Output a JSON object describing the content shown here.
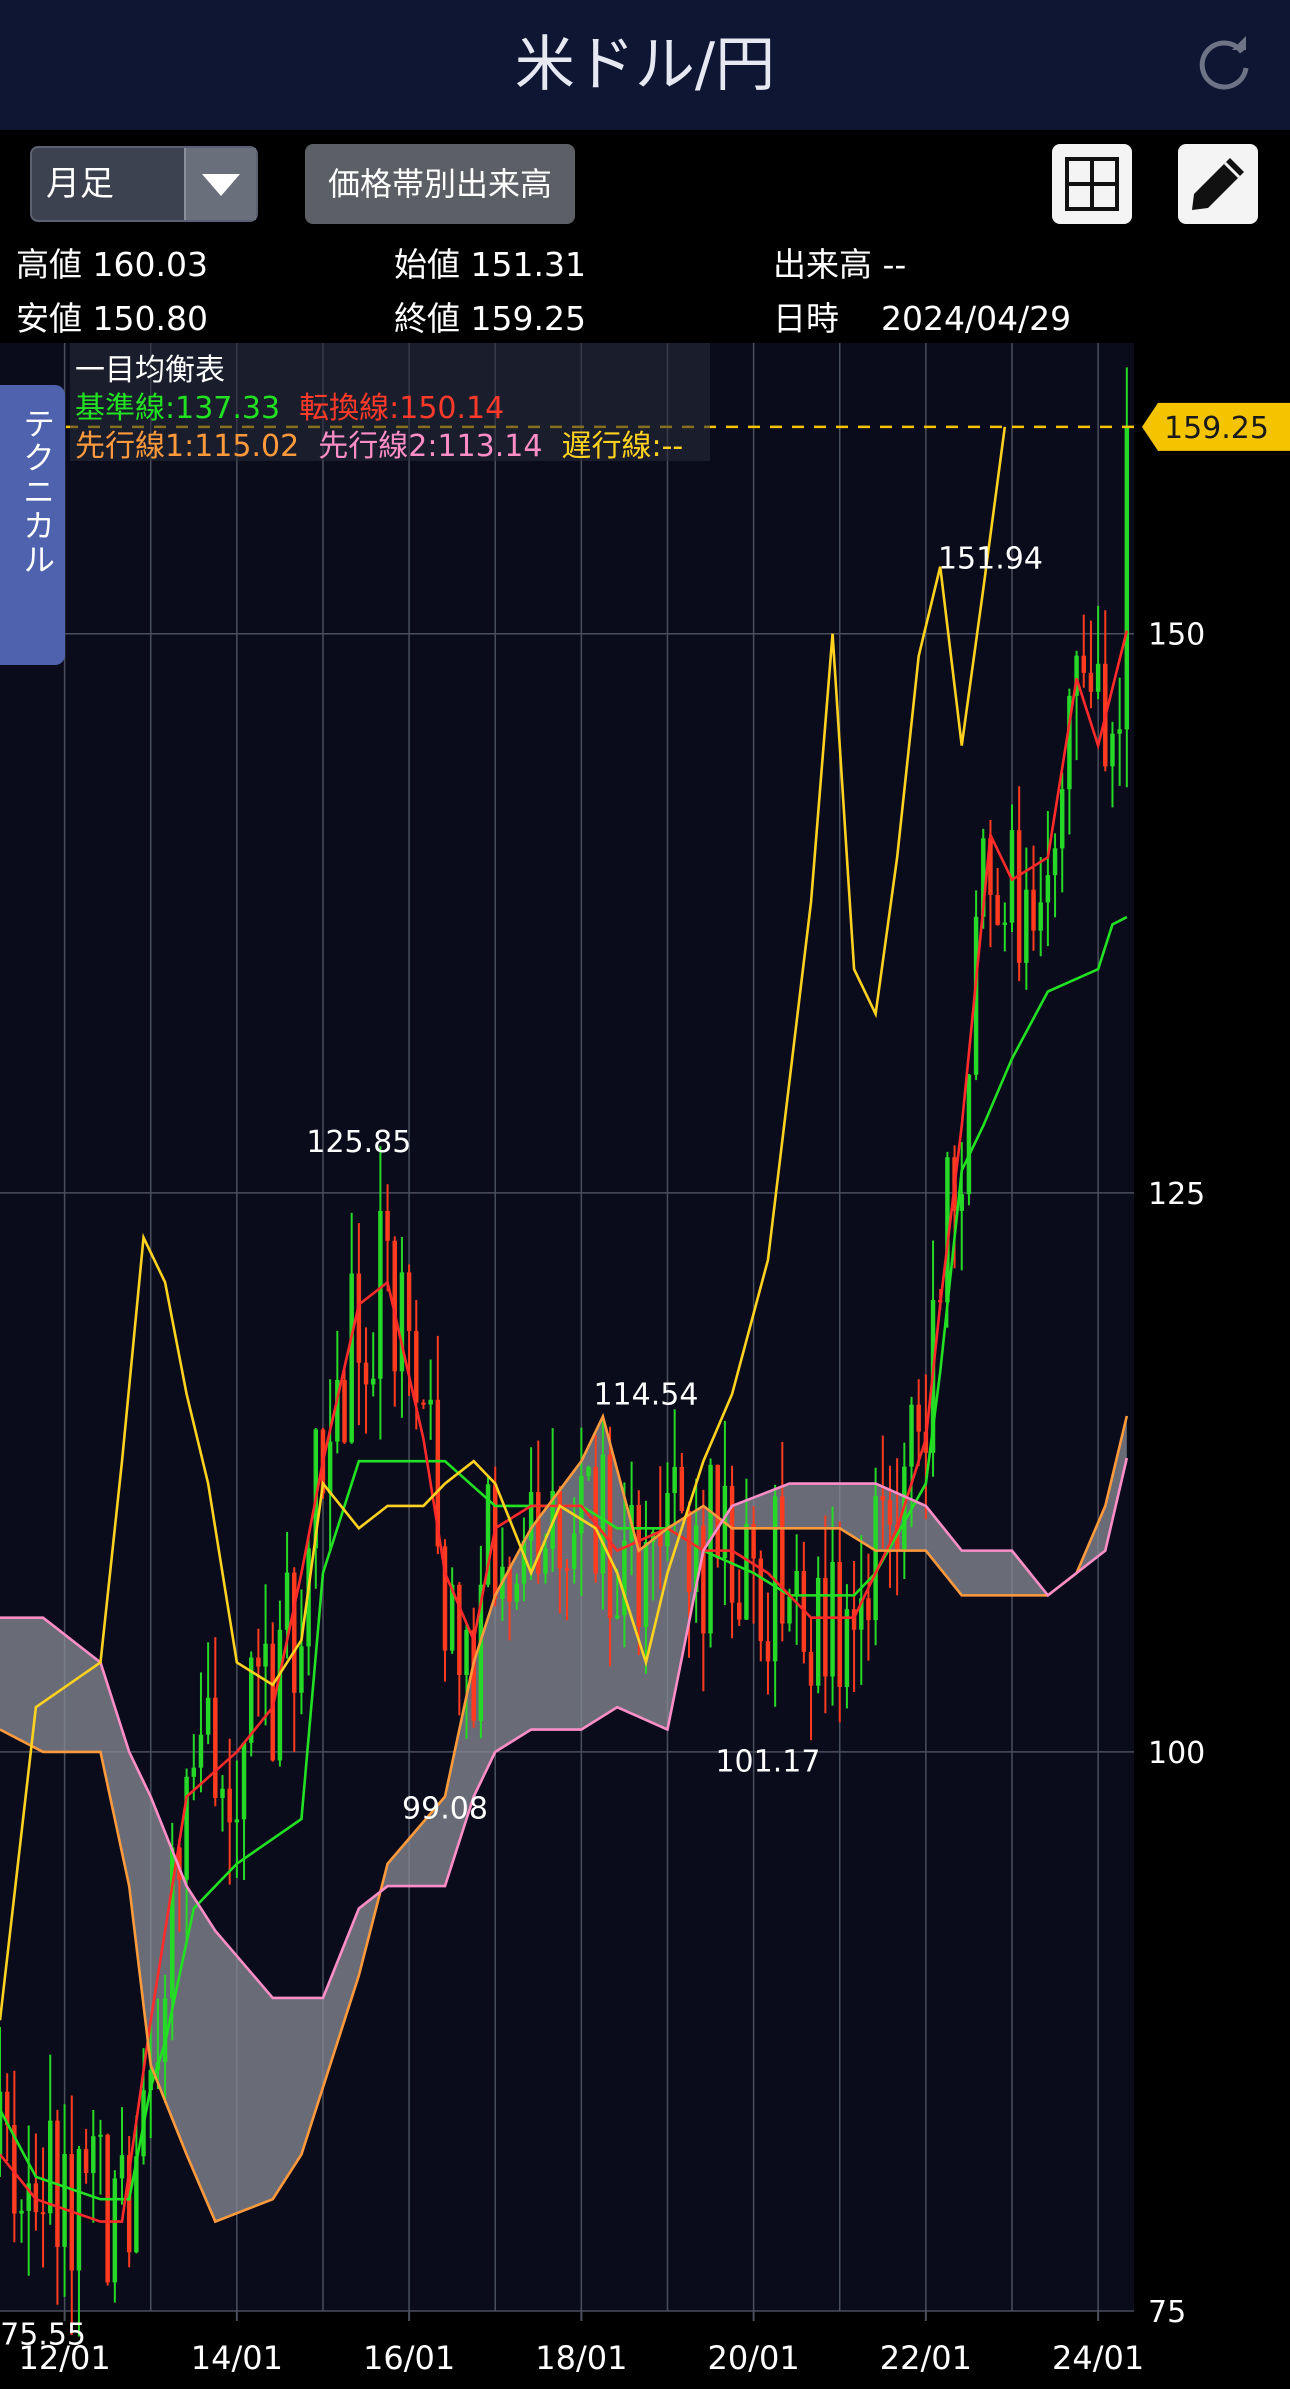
{
  "header": {
    "title": "米ドル/円"
  },
  "toolbar": {
    "period": "月足",
    "volume_profile": "価格帯別出来高"
  },
  "info": {
    "high_label": "高値",
    "high": "160.03",
    "open_label": "始値",
    "open": "151.31",
    "volume_label": "出来高",
    "volume": "--",
    "low_label": "安値",
    "low": "150.80",
    "close_label": "終値",
    "close": "159.25",
    "date_label": "日時",
    "date": "2024/04/29"
  },
  "side_tab": "テクニカル",
  "legend": {
    "name": "一目均衡表",
    "kijun": "基準線:137.33",
    "tenkan": "転換線:150.14",
    "senkou1": "先行線1:115.02",
    "senkou2": "先行線2:113.14",
    "chikou": "遅行線:--"
  },
  "colors": {
    "up": "#26d926",
    "down": "#ff3b1f",
    "kijun": "#22e022",
    "tenkan": "#ff2a2a",
    "senkou1": "#ff9a3c",
    "senkou2": "#ff8ec8",
    "chikou": "#ffd21f",
    "cloud": "#8a8c95",
    "price_tag": "#f5c400",
    "grid": "#4a4f5c",
    "background": "#0a0c1c"
  },
  "chart_data": {
    "type": "candlestick",
    "ylim": [
      75,
      163
    ],
    "y_ticks": [
      75,
      100,
      125,
      150
    ],
    "x_ticks": [
      "12/01",
      "14/01",
      "16/01",
      "18/01",
      "20/01",
      "22/01",
      "24/01"
    ],
    "x_range": [
      "2011/04",
      "2024/06"
    ],
    "last_price": "159.25",
    "annotations": [
      {
        "label": "125.85",
        "date": "2015/06",
        "value": 125.85
      },
      {
        "label": "75.55",
        "date": "2011/10",
        "value": 75.55
      },
      {
        "label": "99.08",
        "date": "2016/06",
        "value": 99.08
      },
      {
        "label": "114.54",
        "date": "2018/10",
        "value": 114.54
      },
      {
        "label": "101.17",
        "date": "2020/03",
        "value": 101.17
      },
      {
        "label": "151.94",
        "date": "2022/10",
        "value": 151.94
      }
    ],
    "series": [
      {
        "name": "基準線",
        "points": [
          [
            "2011/04",
            84
          ],
          [
            "2011/09",
            81
          ],
          [
            "2012/06",
            80
          ],
          [
            "2012/10",
            80
          ],
          [
            "2013/01",
            85
          ],
          [
            "2013/03",
            87
          ],
          [
            "2013/07",
            93
          ],
          [
            "2014/01",
            95
          ],
          [
            "2014/10",
            97
          ],
          [
            "2015/01",
            108
          ],
          [
            "2015/06",
            113
          ],
          [
            "2016/06",
            113
          ],
          [
            "2017/01",
            111
          ],
          [
            "2018/01",
            111
          ],
          [
            "2018/06",
            110
          ],
          [
            "2019/01",
            110
          ],
          [
            "2019/06",
            109
          ],
          [
            "2020/01",
            108
          ],
          [
            "2020/06",
            107
          ],
          [
            "2021/03",
            107
          ],
          [
            "2021/06",
            108
          ],
          [
            "2022/01",
            112
          ],
          [
            "2022/03",
            117
          ],
          [
            "2022/06",
            126
          ],
          [
            "2022/09",
            128
          ],
          [
            "2023/01",
            131
          ],
          [
            "2023/06",
            134
          ],
          [
            "2024/01",
            135
          ],
          [
            "2024/03",
            137
          ],
          [
            "2024/05",
            137.33
          ]
        ]
      },
      {
        "name": "転換線",
        "points": [
          [
            "2011/04",
            82
          ],
          [
            "2011/09",
            80
          ],
          [
            "2012/06",
            79
          ],
          [
            "2012/09",
            79
          ],
          [
            "2013/01",
            88
          ],
          [
            "2013/06",
            98
          ],
          [
            "2014/01",
            100
          ],
          [
            "2014/06",
            102
          ],
          [
            "2014/10",
            108
          ],
          [
            "2015/01",
            113
          ],
          [
            "2015/06",
            120
          ],
          [
            "2015/10",
            121
          ],
          [
            "2016/03",
            114
          ],
          [
            "2016/06",
            108
          ],
          [
            "2016/10",
            105
          ],
          [
            "2017/01",
            110
          ],
          [
            "2017/06",
            111
          ],
          [
            "2018/01",
            111
          ],
          [
            "2018/06",
            109
          ],
          [
            "2019/01",
            110
          ],
          [
            "2019/06",
            109
          ],
          [
            "2019/10",
            109
          ],
          [
            "2020/03",
            108
          ],
          [
            "2020/09",
            106
          ],
          [
            "2021/03",
            106
          ],
          [
            "2021/09",
            110
          ],
          [
            "2022/01",
            114
          ],
          [
            "2022/03",
            120
          ],
          [
            "2022/06",
            128
          ],
          [
            "2022/10",
            141
          ],
          [
            "2023/01",
            139
          ],
          [
            "2023/06",
            140
          ],
          [
            "2023/10",
            148
          ],
          [
            "2024/01",
            145
          ],
          [
            "2024/05",
            150.14
          ]
        ]
      },
      {
        "name": "先行線1",
        "points": [
          [
            "2011/04",
            101
          ],
          [
            "2011/10",
            100
          ],
          [
            "2012/06",
            100
          ],
          [
            "2012/10",
            94
          ],
          [
            "2013/01",
            86
          ],
          [
            "2013/06",
            82
          ],
          [
            "2013/10",
            79
          ],
          [
            "2014/06",
            80
          ],
          [
            "2014/10",
            82
          ],
          [
            "2015/01",
            85
          ],
          [
            "2015/06",
            90
          ],
          [
            "2015/10",
            95
          ],
          [
            "2016/06",
            98
          ],
          [
            "2016/10",
            104
          ],
          [
            "2017/01",
            107
          ],
          [
            "2017/06",
            110
          ],
          [
            "2018/01",
            113
          ],
          [
            "2018/04",
            115
          ],
          [
            "2018/09",
            109
          ],
          [
            "2019/01",
            110
          ],
          [
            "2019/06",
            111
          ],
          [
            "2019/10",
            110
          ],
          [
            "2020/06",
            110
          ],
          [
            "2021/01",
            110
          ],
          [
            "2021/06",
            109
          ],
          [
            "2022/01",
            109
          ],
          [
            "2022/06",
            107
          ],
          [
            "2023/01",
            107
          ],
          [
            "2023/06",
            107
          ],
          [
            "2023/10",
            108
          ],
          [
            "2024/02",
            111
          ],
          [
            "2024/05",
            115.02
          ]
        ]
      },
      {
        "name": "先行線2",
        "points": [
          [
            "2011/04",
            106
          ],
          [
            "2011/10",
            106
          ],
          [
            "2012/06",
            104
          ],
          [
            "2012/10",
            100
          ],
          [
            "2013/01",
            98
          ],
          [
            "2013/06",
            94
          ],
          [
            "2013/10",
            92
          ],
          [
            "2014/06",
            89
          ],
          [
            "2014/10",
            89
          ],
          [
            "2015/01",
            89
          ],
          [
            "2015/06",
            93
          ],
          [
            "2015/10",
            94
          ],
          [
            "2016/06",
            94
          ],
          [
            "2016/10",
            98
          ],
          [
            "2017/01",
            100
          ],
          [
            "2017/06",
            101
          ],
          [
            "2018/01",
            101
          ],
          [
            "2018/06",
            102
          ],
          [
            "2019/01",
            101
          ],
          [
            "2019/06",
            109
          ],
          [
            "2019/10",
            111
          ],
          [
            "2020/06",
            112
          ],
          [
            "2021/01",
            112
          ],
          [
            "2021/06",
            112
          ],
          [
            "2022/01",
            111
          ],
          [
            "2022/06",
            109
          ],
          [
            "2023/01",
            109
          ],
          [
            "2023/06",
            107
          ],
          [
            "2023/10",
            108
          ],
          [
            "2024/02",
            109
          ],
          [
            "2024/05",
            113.14
          ]
        ]
      },
      {
        "name": "遅行線",
        "points": [
          [
            "2011/04",
            88
          ],
          [
            "2011/09",
            102
          ],
          [
            "2012/06",
            104
          ],
          [
            "2012/09",
            113
          ],
          [
            "2012/12",
            123
          ],
          [
            "2013/03",
            121
          ],
          [
            "2013/06",
            116
          ],
          [
            "2013/09",
            112
          ],
          [
            "2014/01",
            104
          ],
          [
            "2014/06",
            103
          ],
          [
            "2014/10",
            105
          ],
          [
            "2015/01",
            112
          ],
          [
            "2015/06",
            110
          ],
          [
            "2015/10",
            111
          ],
          [
            "2016/03",
            111
          ],
          [
            "2016/06",
            112
          ],
          [
            "2016/10",
            113
          ],
          [
            "2017/01",
            112
          ],
          [
            "2017/06",
            108
          ],
          [
            "2017/10",
            111
          ],
          [
            "2018/03",
            110
          ],
          [
            "2018/06",
            108
          ],
          [
            "2018/10",
            104
          ],
          [
            "2019/01",
            108
          ],
          [
            "2019/06",
            113
          ],
          [
            "2019/10",
            116
          ],
          [
            "2020/03",
            122
          ],
          [
            "2020/09",
            138
          ],
          [
            "2020/12",
            150
          ],
          [
            "2021/03",
            135
          ],
          [
            "2021/06",
            133
          ],
          [
            "2021/09",
            140
          ],
          [
            "2021/12",
            149
          ],
          [
            "2022/03",
            153
          ],
          [
            "2022/06",
            145
          ],
          [
            "2022/09",
            152
          ],
          [
            "2022/12",
            159.25
          ]
        ]
      }
    ],
    "candles_note": "monthly candles generated from series"
  }
}
